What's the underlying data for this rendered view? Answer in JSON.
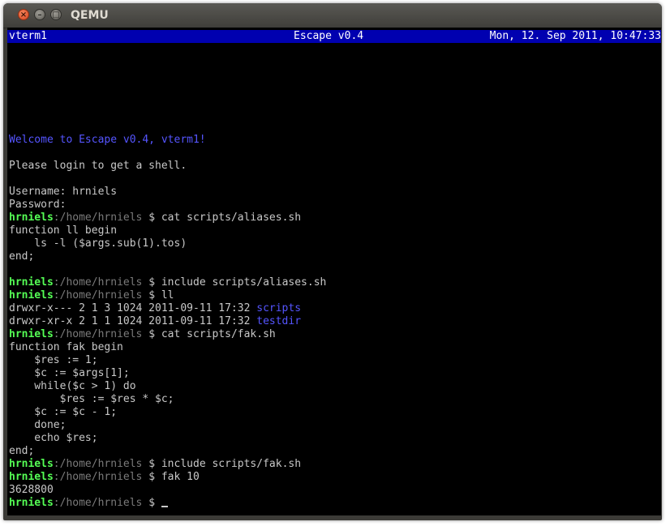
{
  "window": {
    "title": "QEMU"
  },
  "statusbar": {
    "left": "vterm1",
    "center": "Escape v0.4",
    "right": "Mon, 12. Sep 2011, 10:47:33",
    "color": "#0000b0"
  },
  "colors": {
    "prompt_user": "#55ff55",
    "prompt_path": "#7a7a7a",
    "directory": "#5555ff",
    "text": "#c8c8c8",
    "background": "#000000"
  },
  "prompt": {
    "user": "hrniels",
    "path": ":/home/hrniels",
    "symbol": " $ "
  },
  "console": {
    "welcome": "Welcome to Escape v0.4, vterm1!",
    "login_msg": "Please login to get a shell.",
    "username_line": "Username: hrniels",
    "password_line": "Password:",
    "cmd1": "cat scripts/aliases.sh",
    "aliases_file": [
      "function ll begin",
      "    ls -l ($args.sub(1).tos)",
      "end;"
    ],
    "cmd2": "include scripts/aliases.sh",
    "cmd3": "ll",
    "ls_rows": [
      {
        "perm": "drwxr-x--- 2 1 3 1024 2011-09-11 17:32 ",
        "name": "scripts"
      },
      {
        "perm": "drwxr-xr-x 2 1 1 1024 2011-09-11 17:32 ",
        "name": "testdir"
      }
    ],
    "cmd4": "cat scripts/fak.sh",
    "fak_file": [
      "function fak begin",
      "    $res := 1;",
      "    $c := $args[1];",
      "    while($c > 1) do",
      "        $res := $res * $c;",
      "    $c := $c - 1;",
      "    done;",
      "    echo $res;",
      "end;"
    ],
    "cmd5": "include scripts/fak.sh",
    "cmd6": "fak 10",
    "output6": "3628800",
    "current_input": ""
  }
}
